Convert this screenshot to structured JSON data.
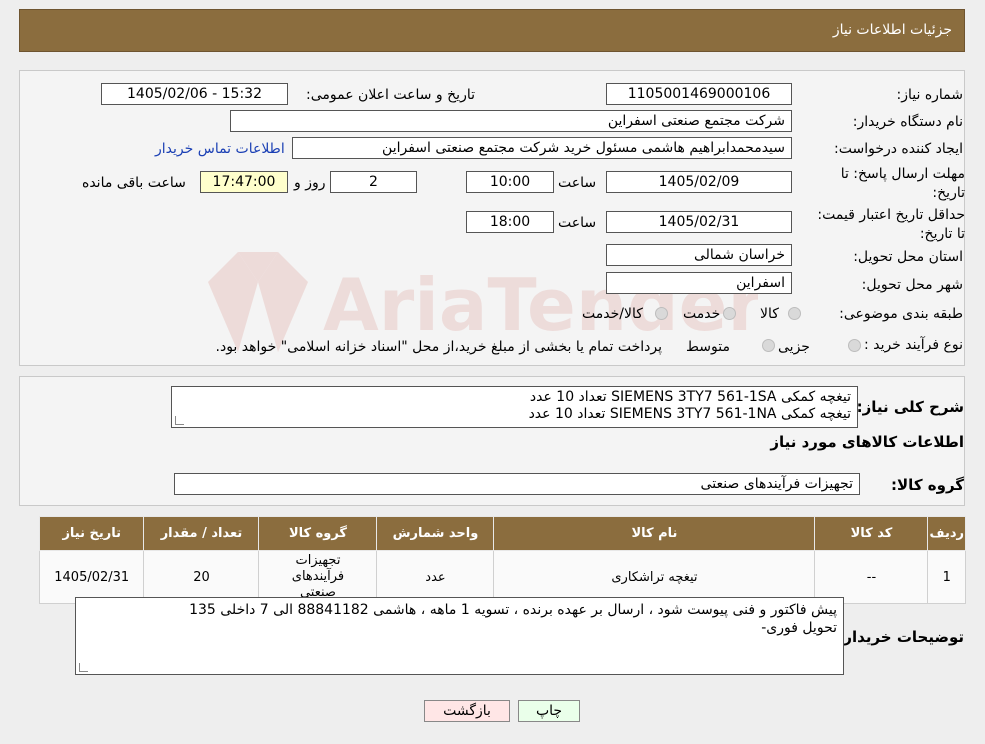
{
  "header": {
    "title": "جزئیات اطلاعات نیاز"
  },
  "form": {
    "need_number_label": "شماره نیاز:",
    "need_number": "1105001469000106",
    "announce_label": "تاریخ و ساعت اعلان عمومی:",
    "announce_value": "1405/02/06 - 15:32",
    "buyer_org_label": "نام دستگاه خریدار:",
    "buyer_org": "شرکت مجتمع صنعتی اسفراین",
    "requester_label": "ایجاد کننده درخواست:",
    "requester": "سیدمحمدابراهیم هاشمی مسئول خرید شرکت مجتمع صنعتی اسفراین",
    "contact_link": "اطلاعات تماس خریدار",
    "reply_deadline_label": "مهلت ارسال پاسخ: تا تاریخ:",
    "reply_date": "1405/02/09",
    "time_label": "ساعت",
    "reply_time": "10:00",
    "days_value": "2",
    "days_label": "روز و",
    "remaining_time": "17:47:00",
    "remaining_label": "ساعت باقی مانده",
    "price_validity_label": "حداقل تاریخ اعتبار قیمت: تا تاریخ:",
    "price_date": "1405/02/31",
    "price_time": "18:00",
    "province_label": "استان محل تحویل:",
    "province": "خراسان شمالی",
    "city_label": "شهر محل تحویل:",
    "city": "اسفراین",
    "category_label": "طبقه بندی موضوعی:",
    "category_options": [
      "کالا",
      "خدمت",
      "کالا/خدمت"
    ],
    "process_label": "نوع فرآیند خرید :",
    "process_options": [
      "جزیی",
      "متوسط"
    ],
    "process_note": "پرداخت تمام یا بخشی از مبلغ خرید،از محل \"اسناد خزانه اسلامی\" خواهد بود."
  },
  "description": {
    "label": "شرح کلی نیاز:",
    "lines": [
      "تیغچه کمکی SIEMENS 3TY7 561-1SA تعداد 10 عدد",
      "تیغچه کمکی SIEMENS 3TY7 561-1NA تعداد 10 عدد"
    ]
  },
  "goods": {
    "section_title": "اطلاعات کالاهای مورد نیاز",
    "group_label": "گروه کالا:",
    "group_value": "تجهیزات فرآیندهای صنعتی",
    "columns": [
      "ردیف",
      "کد کالا",
      "نام کالا",
      "واحد شمارش",
      "گروه کالا",
      "تعداد / مقدار",
      "تاریخ نیاز"
    ],
    "rows": [
      {
        "row": "1",
        "code": "--",
        "name": "تیغچه تراشکاری",
        "unit": "عدد",
        "group": "تجهیزات فرآیندهای صنعتی",
        "qty": "20",
        "date": "1405/02/31"
      }
    ]
  },
  "buyer_notes": {
    "label": "توضیحات خریدار:",
    "lines": [
      "پیش فاکتور و فنی پیوست شود ، ارسال بر عهده برنده ، تسویه 1 ماهه ، هاشمی 88841182 الی 7 داخلی 135",
      "تحویل فوری-"
    ]
  },
  "buttons": {
    "print": "چاپ",
    "back": "بازگشت"
  },
  "watermark": {
    "text": "AriaTender.neT"
  },
  "colors": {
    "header": "#8b6d3e",
    "link": "#1a3fb4",
    "print_btn": "#eaffea",
    "back_btn": "#ffe6e6",
    "highlight": "#ffffcc"
  }
}
